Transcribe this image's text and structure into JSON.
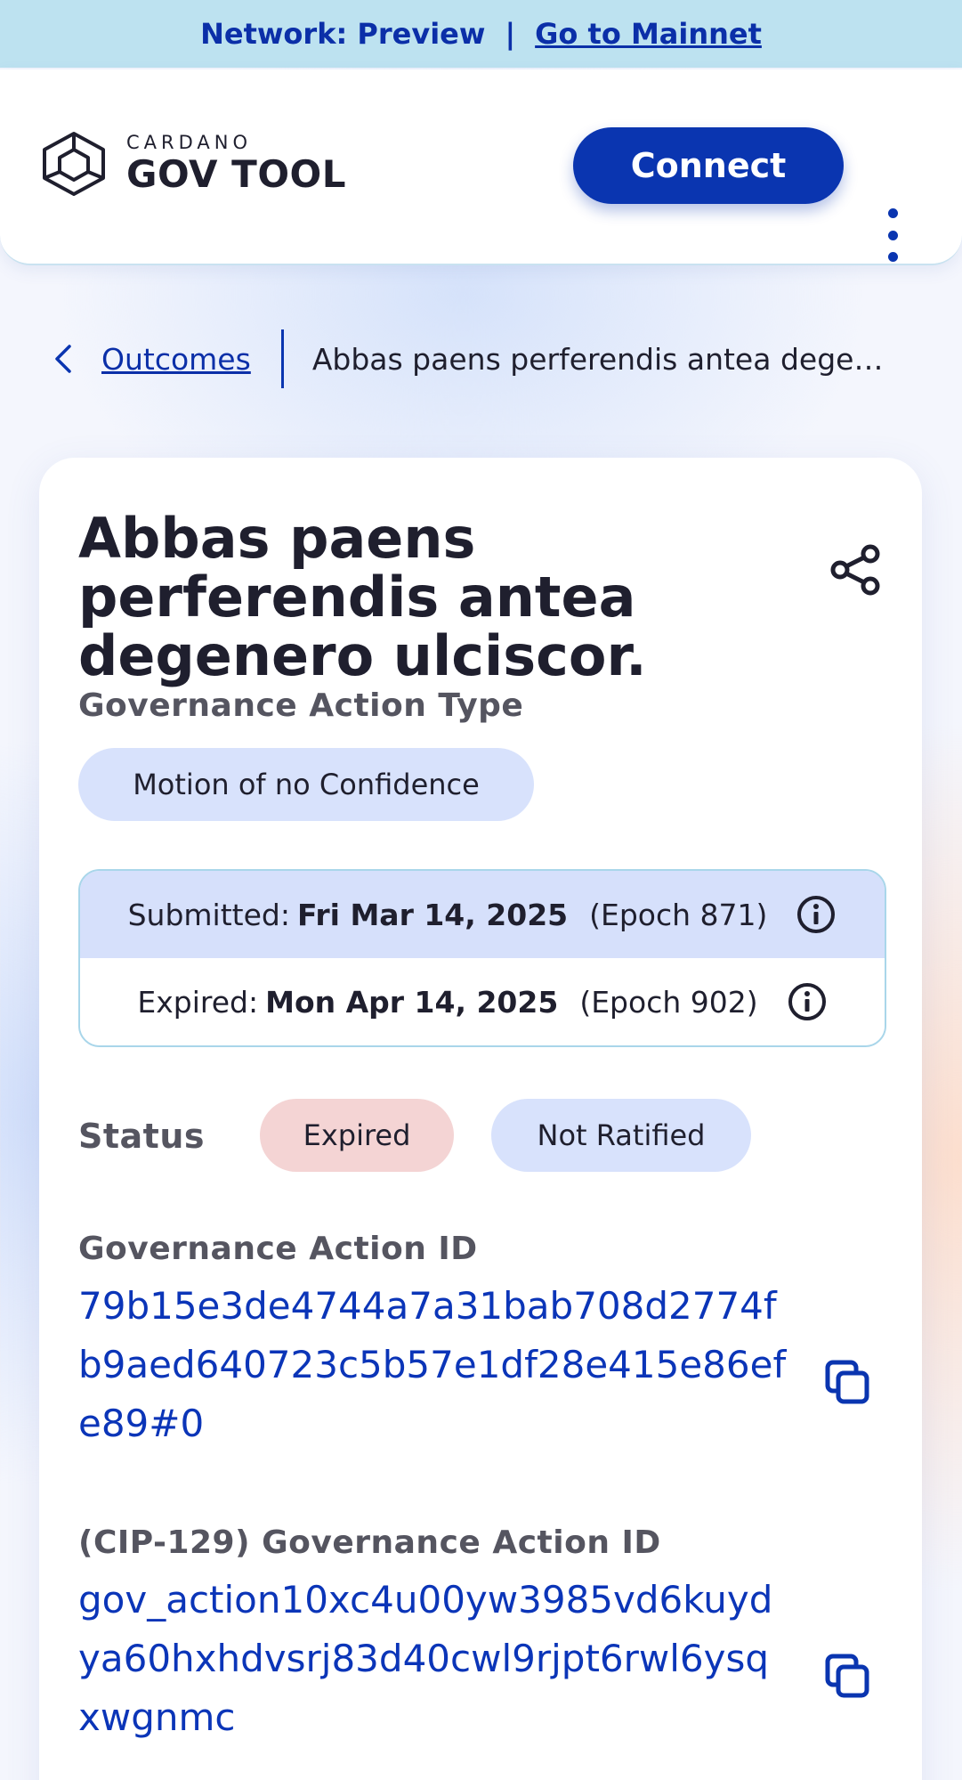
{
  "banner": {
    "network_text": "Network: Preview",
    "separator": "|",
    "mainnet_link": "Go to Mainnet"
  },
  "header": {
    "logo_small": "CARDANO",
    "logo_big": "GOV TOOL",
    "connect_label": "Connect"
  },
  "breadcrumb": {
    "back_link": "Outcomes",
    "current": "Abbas paens perferendis antea degenero ulciscor."
  },
  "action": {
    "title": "Abbas paens perferendis antea degenero ulciscor.",
    "type_label": "Governance Action Type",
    "type_value": "Motion of no Confidence",
    "submitted_label": "Submitted:",
    "submitted_date": "Fri Mar 14, 2025",
    "submitted_epoch": "(Epoch 871)",
    "expired_label": "Expired:",
    "expired_date": "Mon Apr 14, 2025",
    "expired_epoch": "(Epoch 902)",
    "status_label": "Status",
    "status_chips": [
      "Expired",
      "Not Ratified"
    ],
    "id_label": "Governance Action ID",
    "id_value": "79b15e3de4744a7a31bab708d2774fb9aed640723c5b57e1df28e415e86efe89#0",
    "cip129_label": "(CIP-129) Governance Action ID",
    "cip129_value": "gov_action10xc4u00yw3985vd6kuydya60hxhdvsrj83d40cwl9rjpt6rwl6ysqxwgnmc"
  },
  "colors": {
    "primary": "#0a35b0",
    "banner_bg": "#bde2f0",
    "chip_blue": "#d8e2fc",
    "chip_red": "#f4d4d4"
  },
  "icons": [
    "cardano-logo-icon",
    "chevron-left-icon",
    "share-icon",
    "info-icon",
    "copy-icon",
    "more-vertical-icon"
  ]
}
